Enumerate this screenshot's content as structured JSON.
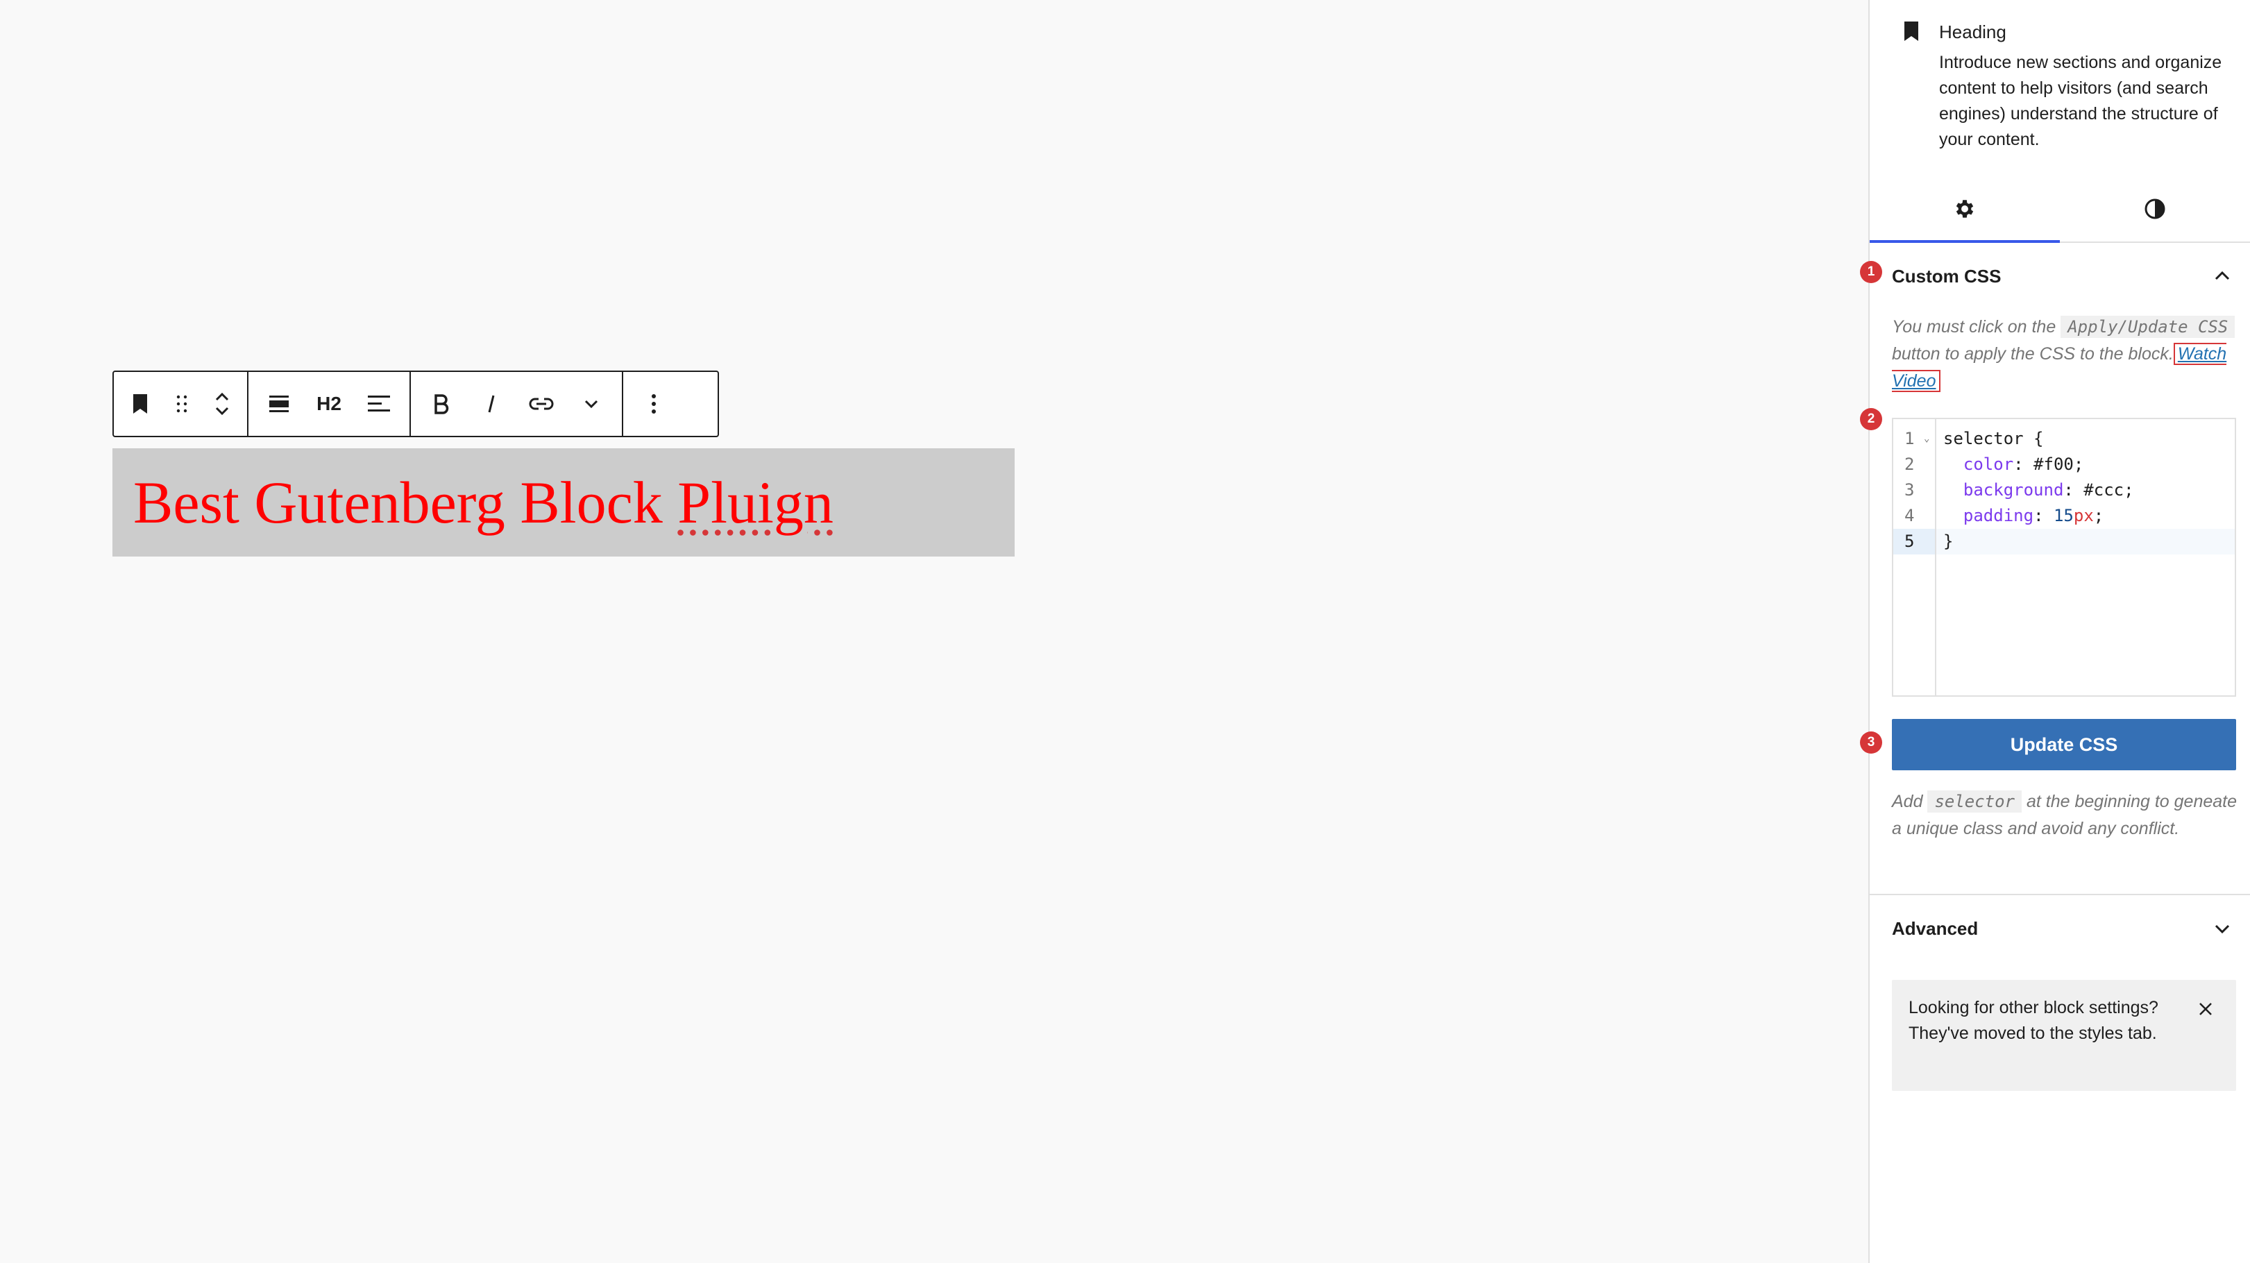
{
  "toolbar": {
    "block_type": "H2"
  },
  "heading_block": {
    "text_prefix": "Best Gutenberg Block ",
    "text_misspelled": "Pluign"
  },
  "sidebar": {
    "block_card": {
      "title": "Heading",
      "description": "Introduce new sections and organize content to help visitors (and search engines) understand the structure of your content."
    },
    "custom_css": {
      "title": "Custom CSS",
      "badge": "1",
      "help_prefix": "You must click on the",
      "help_code": "Apply/Update CSS",
      "help_suffix": "button to apply the CSS to the block.",
      "watch_video": "Watch Video",
      "editor_badge": "2",
      "code_lines": {
        "l1_num": "1",
        "l1_sel": "selector {",
        "l2_num": "2",
        "l2_prop": "color",
        "l2_val": " #f00;",
        "l3_num": "3",
        "l3_prop": "background",
        "l3_val": " #ccc;",
        "l4_num": "4",
        "l4_prop": "padding",
        "l4_num_val": "15",
        "l4_unit": "px",
        "l5_num": "5",
        "l5_close": "}"
      },
      "button_badge": "3",
      "update_button": "Update CSS",
      "hint_prefix": "Add",
      "hint_code": "selector",
      "hint_suffix": "at the beginning to geneate a unique class and avoid any conflict."
    },
    "advanced": {
      "title": "Advanced"
    },
    "notice": {
      "text": "Looking for other block settings? They've moved to the styles tab."
    }
  },
  "colors": {
    "accent": "#3858e9",
    "button": "#3570b5",
    "badge": "#d63638",
    "heading_text": "#ff0000",
    "heading_bg": "#cccccc"
  }
}
